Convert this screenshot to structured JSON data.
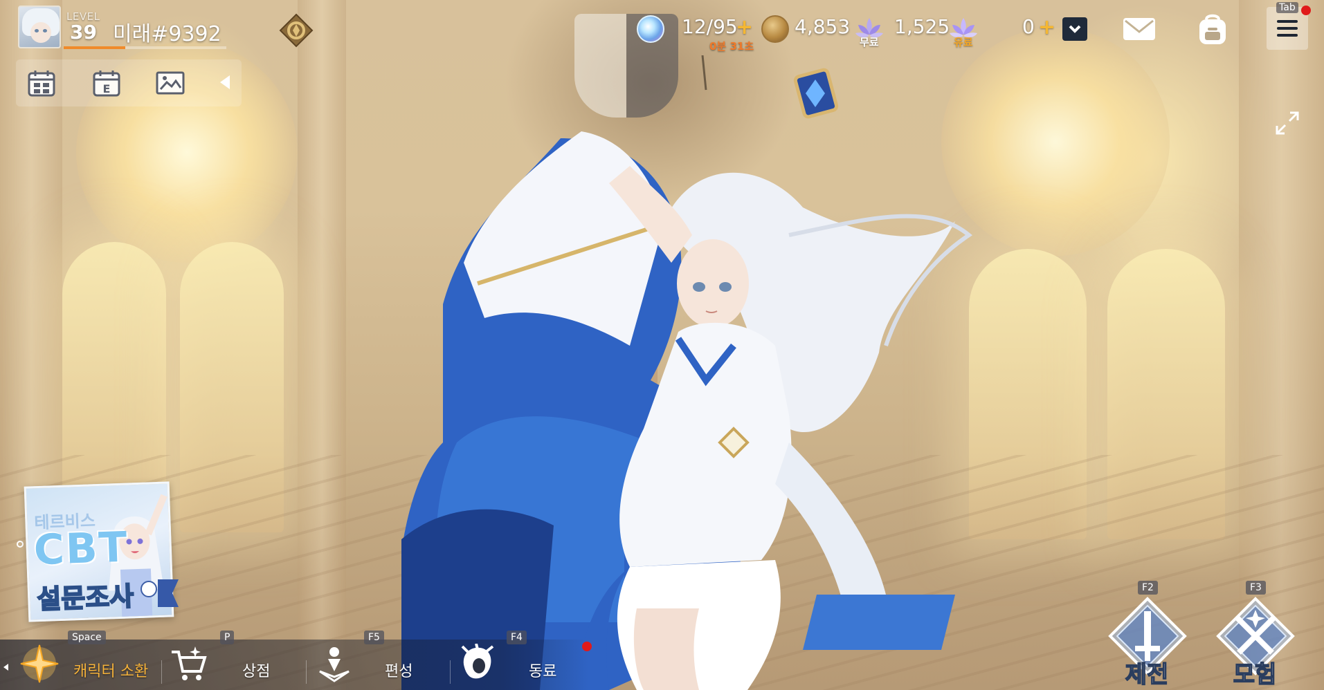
{
  "player": {
    "level_label": "LEVEL",
    "level": "39",
    "name": "미래#9392",
    "xp_progress": 0.38
  },
  "resources": {
    "stamina": "12/95",
    "stamina_plus": "+",
    "stamina_timer": "0분 31초",
    "gold": "4,853",
    "free_gem": "1,525",
    "free_gem_label": "무료",
    "paid_gem": "0",
    "paid_gem_label": "유료",
    "paid_gem_plus": "+"
  },
  "top_right": {
    "tab_hint": "Tab"
  },
  "survey_banner": {
    "top_text": "테르비스",
    "main_text": "CBT",
    "bottom_text": "설문조사"
  },
  "bottom_nav": [
    {
      "hotkey": "Space",
      "label": "캐릭터 소환",
      "icon": "summon-star-icon"
    },
    {
      "hotkey": "P",
      "label": "상점",
      "icon": "shop-cart-icon"
    },
    {
      "hotkey": "F5",
      "label": "편성",
      "icon": "formation-pin-icon"
    },
    {
      "hotkey": "F4",
      "label": "동료",
      "icon": "companion-head-icon"
    }
  ],
  "big_buttons": [
    {
      "hotkey": "F2",
      "label": "제전",
      "icon": "sword-emblem-icon"
    },
    {
      "hotkey": "F3",
      "label": "모험",
      "icon": "crossed-swords-icon"
    }
  ],
  "colors": {
    "accent_gold": "#f5b23a",
    "xp_orange": "#f08a2a",
    "notification_red": "#e01a1a",
    "emblem_blue": "#3d72c9"
  }
}
